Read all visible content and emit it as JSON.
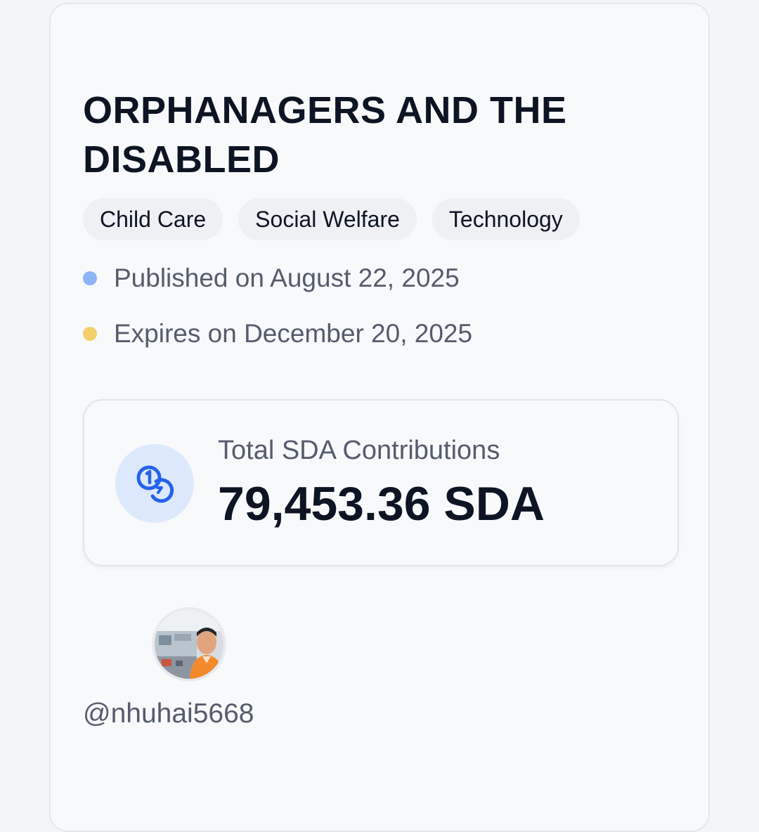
{
  "campaign": {
    "title": "ORPHANAGERS AND THE DISABLED",
    "tags": [
      "Child Care",
      "Social Welfare",
      "Technology"
    ],
    "published": "Published on August 22, 2025",
    "expires": "Expires on December 20, 2025",
    "dot_colors": {
      "published": "#8db4f7",
      "expires": "#f2cf6b"
    }
  },
  "contributions": {
    "icon": "coins-icon",
    "label": "Total SDA Contributions",
    "value": "79,453.36 SDA",
    "accent": "#2563eb"
  },
  "creator": {
    "avatar_icon": "user-avatar-photo",
    "username": "@nhuhai5668"
  }
}
